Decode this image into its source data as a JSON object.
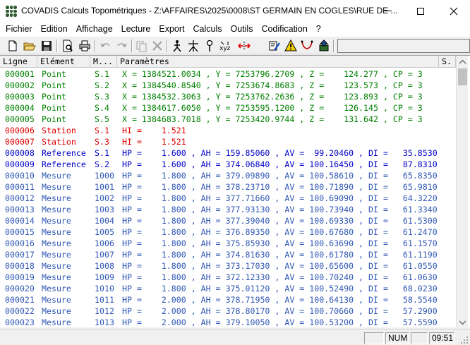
{
  "window": {
    "title": "COVADIS Calculs Topométriques - Z:\\AFFAIRES\\2025\\0008\\ST GERMAIN EN COGLES\\RUE DE ...",
    "app_icon": "covadis-app-icon",
    "controls": [
      "minimize-icon",
      "maximize-icon",
      "close-icon"
    ]
  },
  "menu": [
    "Fichier",
    "Edition",
    "Affichage",
    "Lecture",
    "Export",
    "Calculs",
    "Outils",
    "Codification",
    "?"
  ],
  "toolbar": {
    "icons": [
      "new-file-icon",
      "open-folder-icon",
      "save-icon",
      "print-preview-icon",
      "print-icon",
      "undo-icon",
      "redo-icon",
      "copy-icon",
      "delete-icon",
      "station-icon",
      "reference-icon",
      "point-pin-icon",
      "xyz-icon",
      "arrows-icon",
      "edit-sketch-icon",
      "warning-icon",
      "curve-icon",
      "export-icon"
    ],
    "combo_value": ""
  },
  "table": {
    "headers": {
      "ligne": "Ligne",
      "element": "Elément",
      "mat": "M...",
      "params": "Paramètres",
      "s": "S."
    },
    "rows": [
      {
        "ligne": "000001",
        "element": "Point",
        "mat": "S.1",
        "params": "X = 1384521.0034 , Y = 7253796.2709 , Z =    124.277 , CP = 3",
        "kind": "point"
      },
      {
        "ligne": "000002",
        "element": "Point",
        "mat": "S.2",
        "params": "X = 1384540.8540 , Y = 7253674.8683 , Z =    123.573 , CP = 3",
        "kind": "point"
      },
      {
        "ligne": "000003",
        "element": "Point",
        "mat": "S.3",
        "params": "X = 1384532.3063 , Y = 7253762.2636 , Z =    123.893 , CP = 3",
        "kind": "point"
      },
      {
        "ligne": "000004",
        "element": "Point",
        "mat": "S.4",
        "params": "X = 1384617.6050 , Y = 7253595.1200 , Z =    126.145 , CP = 3",
        "kind": "point"
      },
      {
        "ligne": "000005",
        "element": "Point",
        "mat": "S.5",
        "params": "X = 1384683.7018 , Y = 7253420.9744 , Z =    131.642 , CP = 3",
        "kind": "point"
      },
      {
        "ligne": "000006",
        "element": "Station",
        "mat": "S.1",
        "params": "HI =    1.521",
        "kind": "station"
      },
      {
        "ligne": "000007",
        "element": "Station",
        "mat": "S.3",
        "params": "HI =    1.521",
        "kind": "station"
      },
      {
        "ligne": "000008",
        "element": "Reference",
        "mat": "S.1",
        "params": "HP =    1.600 , AH = 159.85060 , AV =  99.20460 , DI =   35.8530",
        "kind": "reference"
      },
      {
        "ligne": "000009",
        "element": "Reference",
        "mat": "S.2",
        "params": "HP =    1.600 , AH = 374.06840 , AV = 100.16450 , DI =   87.8310",
        "kind": "reference"
      },
      {
        "ligne": "000010",
        "element": "Mesure",
        "mat": "1000",
        "params": "HP =    1.800 , AH = 379.09890 , AV = 100.58610 , DI =   65.8350",
        "kind": "mesure"
      },
      {
        "ligne": "000011",
        "element": "Mesure",
        "mat": "1001",
        "params": "HP =    1.800 , AH = 378.23710 , AV = 100.71890 , DI =   65.9810",
        "kind": "mesure"
      },
      {
        "ligne": "000012",
        "element": "Mesure",
        "mat": "1002",
        "params": "HP =    1.800 , AH = 377.71660 , AV = 100.69090 , DI =   64.3220",
        "kind": "mesure"
      },
      {
        "ligne": "000013",
        "element": "Mesure",
        "mat": "1003",
        "params": "HP =    1.800 , AH = 377.93130 , AV = 100.73940 , DI =   61.3340",
        "kind": "mesure"
      },
      {
        "ligne": "000014",
        "element": "Mesure",
        "mat": "1004",
        "params": "HP =    1.800 , AH = 377.39040 , AV = 100.69330 , DI =   61.5300",
        "kind": "mesure"
      },
      {
        "ligne": "000015",
        "element": "Mesure",
        "mat": "1005",
        "params": "HP =    1.800 , AH = 376.89350 , AV = 100.67680 , DI =   61.2470",
        "kind": "mesure"
      },
      {
        "ligne": "000016",
        "element": "Mesure",
        "mat": "1006",
        "params": "HP =    1.800 , AH = 375.85930 , AV = 100.63690 , DI =   61.1570",
        "kind": "mesure"
      },
      {
        "ligne": "000017",
        "element": "Mesure",
        "mat": "1007",
        "params": "HP =    1.800 , AH = 374.81630 , AV = 100.61780 , DI =   61.1190",
        "kind": "mesure"
      },
      {
        "ligne": "000018",
        "element": "Mesure",
        "mat": "1008",
        "params": "HP =    1.800 , AH = 373.17030 , AV = 100.65600 , DI =   61.0550",
        "kind": "mesure"
      },
      {
        "ligne": "000019",
        "element": "Mesure",
        "mat": "1009",
        "params": "HP =    1.800 , AH = 372.12330 , AV = 100.70240 , DI =   61.0630",
        "kind": "mesure"
      },
      {
        "ligne": "000020",
        "element": "Mesure",
        "mat": "1010",
        "params": "HP =    1.800 , AH = 375.01120 , AV = 100.52490 , DI =   68.0230",
        "kind": "mesure"
      },
      {
        "ligne": "000021",
        "element": "Mesure",
        "mat": "1011",
        "params": "HP =    2.000 , AH = 378.71950 , AV = 100.64130 , DI =   58.5540",
        "kind": "mesure"
      },
      {
        "ligne": "000022",
        "element": "Mesure",
        "mat": "1012",
        "params": "HP =    2.000 , AH = 378.80170 , AV = 100.70660 , DI =   57.2900",
        "kind": "mesure"
      },
      {
        "ligne": "000023",
        "element": "Mesure",
        "mat": "1013",
        "params": "HP =    2.000 , AH = 379.10050 , AV = 100.53200 , DI =   57.5590",
        "kind": "mesure"
      }
    ]
  },
  "colors": {
    "point": "#008000",
    "station": "#e00000",
    "reference": "#0000c8",
    "mesure": "#3057b5"
  },
  "status": {
    "num": "NUM",
    "time": "09:51"
  }
}
